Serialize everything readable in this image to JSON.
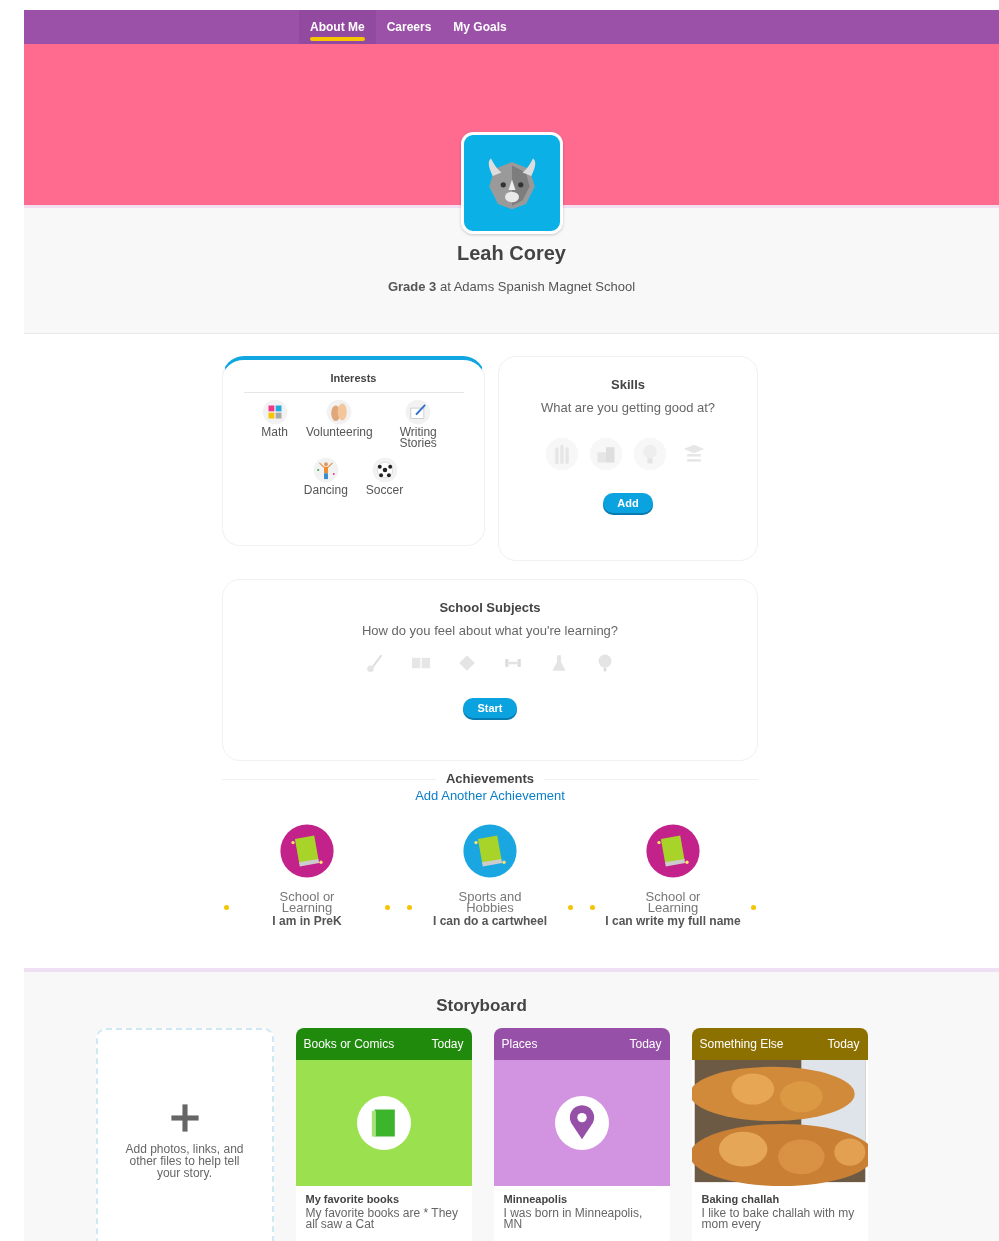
{
  "tabs": [
    {
      "label": "About Me",
      "selected": true
    },
    {
      "label": "Careers",
      "selected": false
    },
    {
      "label": "My Goals",
      "selected": false
    }
  ],
  "profile": {
    "name": "Leah Corey",
    "subtitle": "**Grade 3** at Adams Spanish Magnet School"
  },
  "interests": {
    "title": "Interests",
    "items": [
      {
        "label": "Math",
        "kind": "math"
      },
      {
        "label": "Volunteering",
        "kind": "hands"
      },
      {
        "label": "Writing Stories",
        "kind": "writing"
      },
      {
        "label": "Dancing",
        "kind": "dancing"
      },
      {
        "label": "Soccer",
        "kind": "soccer"
      }
    ]
  },
  "skills": {
    "title": "Skills",
    "prompt": "What are you getting good at?",
    "button": "Add"
  },
  "subjects": {
    "title": "School Subjects",
    "prompt": "How do you feel about what you're learning?",
    "button": "Start"
  },
  "achievements": {
    "title": "Achievements",
    "link": "Add Another Achievement",
    "items": [
      {
        "category": "School or Learning",
        "text": "I am in PreK",
        "color": "#c2228a"
      },
      {
        "category": "Sports and Hobbies",
        "text": "I can do a cartwheel",
        "color": "#1aa6e0"
      },
      {
        "category": "School or Learning",
        "text": "I can write my full name",
        "color": "#c2228a"
      }
    ]
  },
  "storyboard": {
    "title": "Storyboard",
    "add_text": "Add photos, links, and other files to help tell your story.",
    "cards": [
      {
        "category": "Books or Comics",
        "date": "Today",
        "title": "My favorite books",
        "text": "My favorite books are * They all saw a Cat",
        "kind": "book",
        "color": "#1f8a0c"
      },
      {
        "category": "Places",
        "date": "Today",
        "title": "Minneapolis",
        "text": "I was born in Minneapolis, MN",
        "kind": "place",
        "color": "#9750a8"
      },
      {
        "category": "Something Else",
        "date": "Today",
        "title": "Baking challah",
        "text": "I like to bake challah with my mom every",
        "kind": "picture",
        "color": "#8c7000"
      }
    ]
  }
}
